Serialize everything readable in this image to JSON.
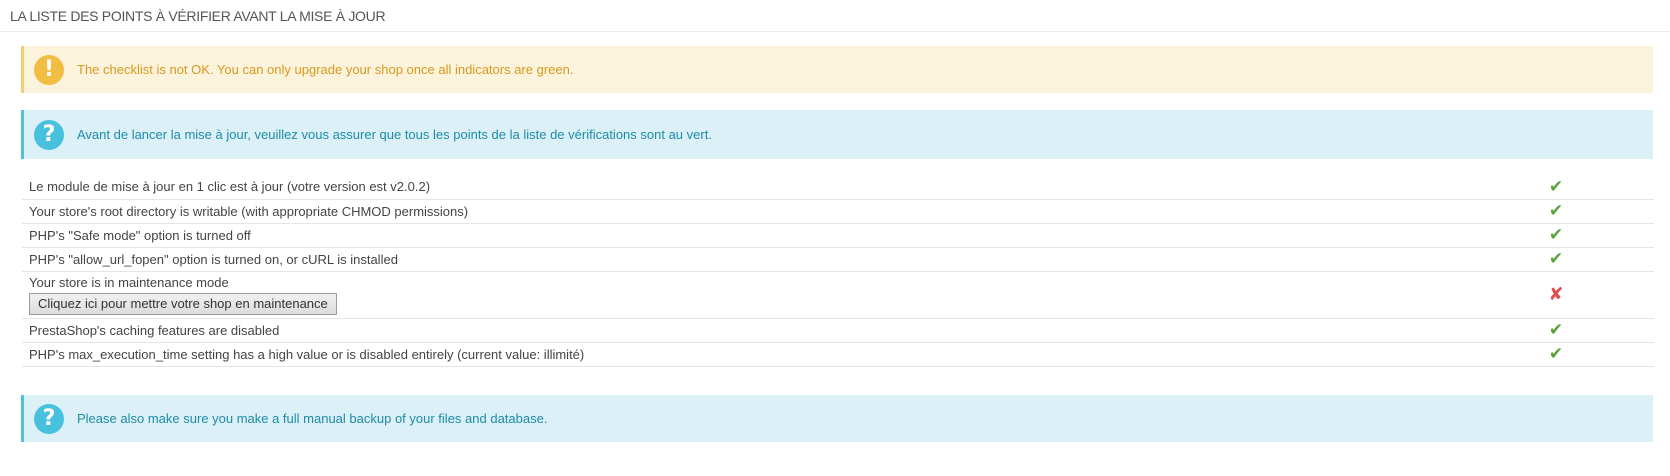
{
  "panel": {
    "title": "LA LISTE DES POINTS À VÉRIFIER AVANT LA MISE À JOUR"
  },
  "alerts": {
    "warning": {
      "icon": "exclamation-icon",
      "text": "The checklist is not OK. You can only upgrade your shop once all indicators are green."
    },
    "info_before": {
      "icon": "question-icon",
      "text": "Avant de lancer la mise à jour, veuillez vous assurer que tous les points de la liste de vérifications sont au vert."
    },
    "info_backup": {
      "icon": "question-icon",
      "text": "Please also make sure you make a full manual backup of your files and database."
    }
  },
  "checklist": [
    {
      "label": "Le module de mise à jour en 1 clic est à jour (votre version est v2.0.2)",
      "status": "ok",
      "status_icon": "check-icon"
    },
    {
      "label": "Your store's root directory is writable (with appropriate CHMOD permissions)",
      "status": "ok",
      "status_icon": "check-icon"
    },
    {
      "label": "PHP's \"Safe mode\" option is turned off",
      "status": "ok",
      "status_icon": "check-icon"
    },
    {
      "label": "PHP's \"allow_url_fopen\" option is turned on, or cURL is installed",
      "status": "ok",
      "status_icon": "check-icon"
    },
    {
      "label": "Your store is in maintenance mode",
      "status": "fail",
      "status_icon": "cross-icon",
      "button_label": "Cliquez ici pour mettre votre shop en maintenance"
    },
    {
      "label": "PrestaShop's caching features are disabled",
      "status": "ok",
      "status_icon": "check-icon"
    },
    {
      "label": "PHP's max_execution_time setting has a high value or is disabled entirely (current value: illimité)",
      "status": "ok",
      "status_icon": "check-icon"
    }
  ],
  "colors": {
    "ok": "#58a23a",
    "fail": "#e34d4d",
    "warning_bg": "#fcf3dc",
    "info_bg": "#dbf1f7"
  }
}
